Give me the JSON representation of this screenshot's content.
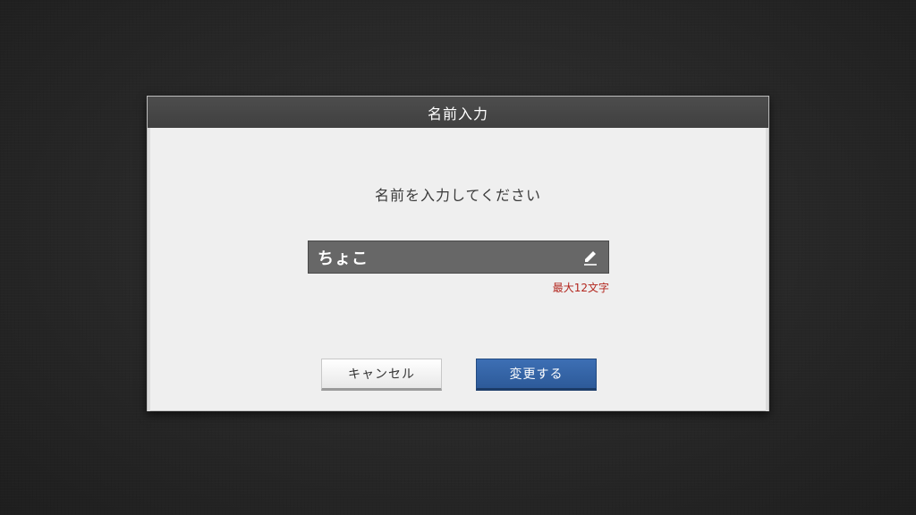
{
  "dialog": {
    "title": "名前入力",
    "prompt": "名前を入力してください",
    "name_value": "ちょこ",
    "limit_note": "最大12文字",
    "edit_icon": "pencil-icon",
    "cancel_label": "キャンセル",
    "confirm_label": "変更する"
  },
  "colors": {
    "header_bg": "#444444",
    "dialog_bg": "#efefef",
    "field_bg": "#676767",
    "note_red": "#b3261e",
    "confirm_blue": "#3464a8"
  }
}
